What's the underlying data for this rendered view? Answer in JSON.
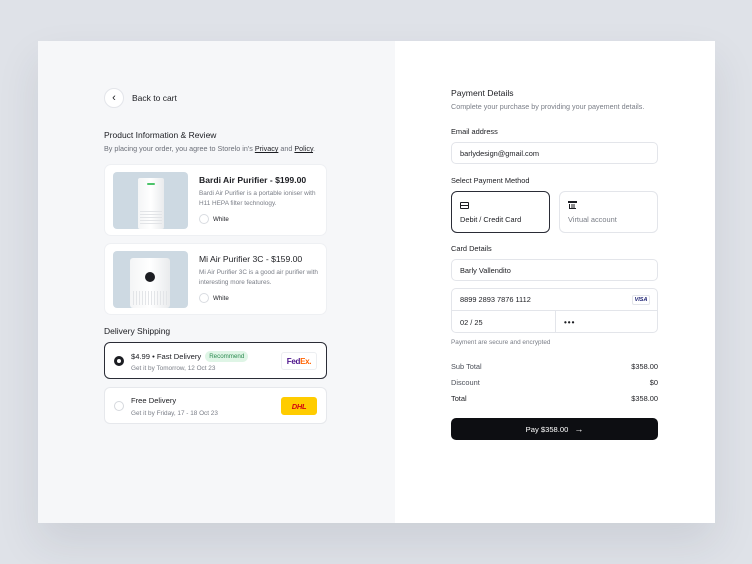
{
  "back": {
    "label": "Back to cart"
  },
  "product_info": {
    "title": "Product Information & Review",
    "subtitle_pre": "By placing your order, you agree to Storelo in's",
    "privacy_link": "Privacy",
    "and": "and",
    "policy_link": "Policy",
    "period": "."
  },
  "products": [
    {
      "name": "Bardi Air Purifier - $199.00",
      "desc": "Bardi Air Purifier is a portable ioniser with H11 HEPA filter technology.",
      "color": "White"
    },
    {
      "name": "Mi Air Purifier 3C - $159.00",
      "desc": "Mi Air Purifier 3C is a good air purifier with interesting more features.",
      "color": "White"
    }
  ],
  "shipping": {
    "title": "Delivery Shipping",
    "options": [
      {
        "name": "$4.99 • Fast Delivery",
        "badge": "Recommend",
        "eta": "Get it by Tomorrow, 12 Oct 23",
        "carrier_a": "Fed",
        "carrier_b": "Ex.",
        "selected": true
      },
      {
        "name": "Free Delivery",
        "eta": "Get it by Friday, 17 - 18 Oct 23",
        "carrier": "DHL",
        "selected": false
      }
    ]
  },
  "payment": {
    "title": "Payment Details",
    "subtitle": "Complete your purchase by providing your payement details.",
    "email_label": "Email address",
    "email_value": "barlydesign@gmail.com",
    "method_label": "Select Payment Method",
    "methods": [
      {
        "label": "Debit / Credit Card",
        "icon": "credit-card-icon",
        "selected": true
      },
      {
        "label": "Virtual account",
        "icon": "bank-icon",
        "selected": false
      }
    ],
    "card_label": "Card Details",
    "card_name": "Barly Vallendito",
    "card_number": "8899 2893 7876 1112",
    "card_brand": "VISA",
    "card_expiry": "02 / 25",
    "card_cvc": "•••",
    "secure_note": "Payment are secure and encrypted"
  },
  "summary": {
    "subtotal_label": "Sub Total",
    "subtotal_value": "$358.00",
    "discount_label": "Discount",
    "discount_value": "$0",
    "total_label": "Total",
    "total_value": "$358.00"
  },
  "pay_button": {
    "label": "Pay $358.00",
    "arrow": "→"
  },
  "colors": {
    "accent": "#0d0e12",
    "recommend_bg": "#dff5e6",
    "recommend_text": "#2b8a4f",
    "left_bg": "#f6f7f9"
  }
}
